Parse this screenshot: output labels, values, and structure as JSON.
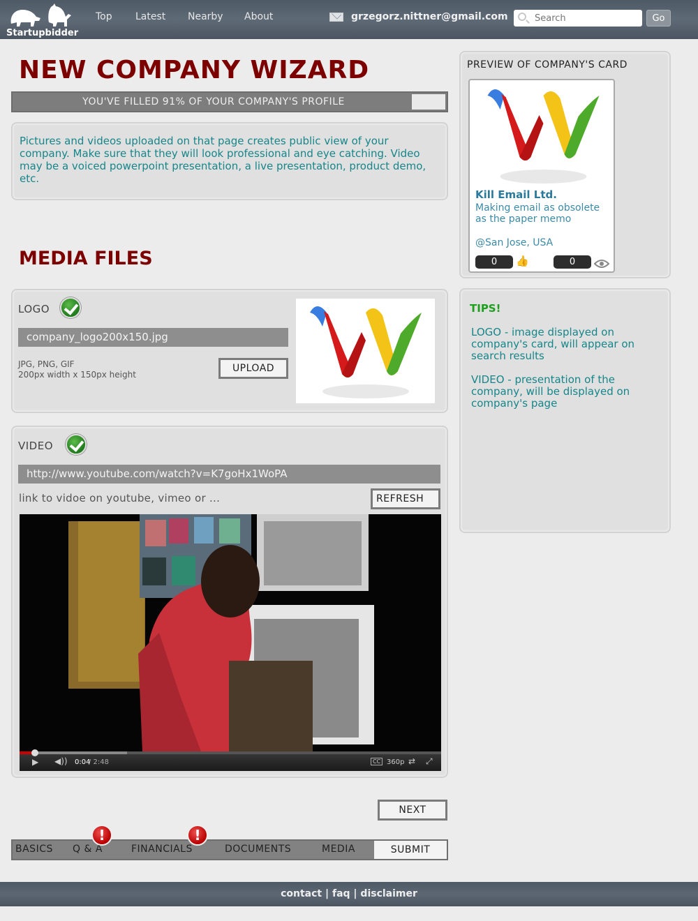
{
  "header": {
    "brand": "Startupbidder",
    "nav": [
      "Top",
      "Latest",
      "Nearby",
      "About"
    ],
    "email": "grzegorz.nittner@gmail.com",
    "search_placeholder": "Search",
    "go_label": "Go"
  },
  "wizard": {
    "title": "NEW COMPANY WIZARD",
    "progress_text": "YOU'VE FILLED 91% OF YOUR COMPANY'S PROFILE",
    "progress_fraction": 0.91,
    "intro": "Pictures and videos uploaded on that page creates public view of your company. Make sure that they will look professional and eye catching. Video may be a voiced powerpoint presentation, a live presentation, product demo, etc.",
    "section_title": "MEDIA FILES"
  },
  "logo": {
    "label": "LOGO",
    "filename": "company_logo200x150.jpg",
    "formats": "JPG, PNG, GIF",
    "dimensions": "200px width x 150px height",
    "upload_label": "UPLOAD"
  },
  "video": {
    "label": "VIDEO",
    "url": "http://www.youtube.com/watch?v=K7goHx1WoPA",
    "hint": "link to vidoe on youtube, vimeo or ...",
    "refresh_label": "REFRESH",
    "time_current": "0:04",
    "time_total": "/ 2:48",
    "cc_label": "CC",
    "quality": "360p",
    "played_fraction": 0.024
  },
  "next_label": "NEXT",
  "tabs": [
    "BASICS",
    "Q & A",
    "FINANCIALS",
    "DOCUMENTS",
    "MEDIA",
    "SUBMIT"
  ],
  "tab_warning_mark": "!",
  "preview": {
    "title": "PREVIEW OF COMPANY'S CARD",
    "company_name": "Kill Email Ltd.",
    "description": "Making email as obsolete as the paper memo",
    "location": "@San Jose, USA",
    "votes": "0",
    "views": "0"
  },
  "tips": {
    "title": "TIPS!",
    "logo_tip": "LOGO - image displayed on company's card, will appear on search results",
    "video_tip": "VIDEO - presentation of the company, will be displayed on company's page"
  },
  "footer": {
    "links": [
      "contact",
      "faq",
      "disclaimer"
    ],
    "separator": "|"
  },
  "colors": {
    "title_red": "#7c0000",
    "teal_text": "#16868a",
    "tips_green": "#1e9f1e"
  }
}
